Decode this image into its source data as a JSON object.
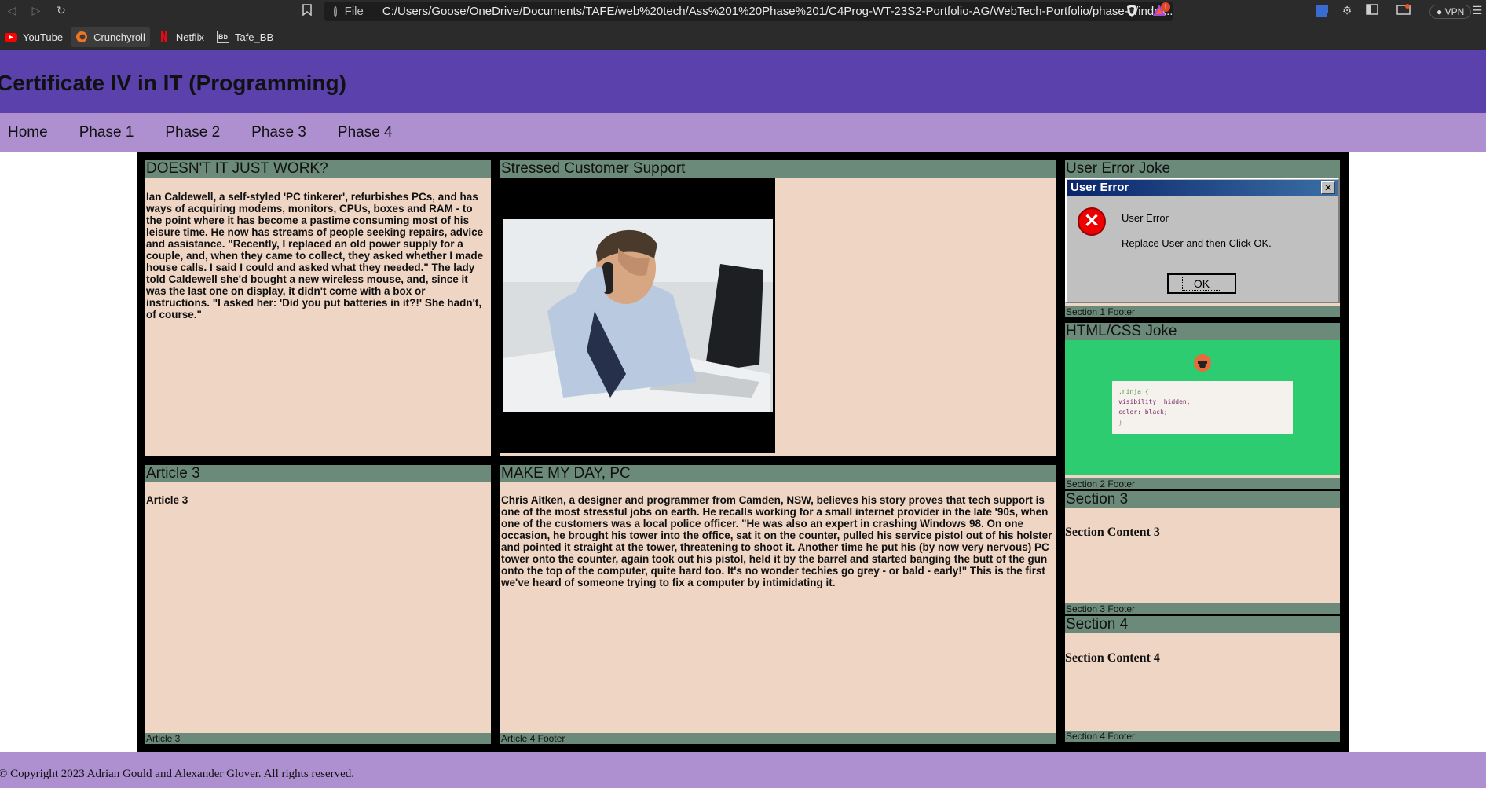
{
  "browser": {
    "address_prefix": "File",
    "url": "C:/Users/Goose/OneDrive/Documents/TAFE/web%20tech/Ass%201%20Phase%201/C4Prog-WT-23S2-Portfolio-AG/WebTech-Portfolio/phase-3/index...",
    "vpn_label": "VPN",
    "notification_count": "1",
    "bookmarks": [
      {
        "label": "YouTube",
        "icon": "youtube-icon"
      },
      {
        "label": "Crunchyroll",
        "icon": "crunchyroll-icon"
      },
      {
        "label": "Netflix",
        "icon": "netflix-icon"
      },
      {
        "label": "Tafe_BB",
        "icon": "blackboard-icon"
      }
    ]
  },
  "site": {
    "title": "Certificate IV in IT (Programming)",
    "nav": [
      "Home",
      "Phase 1",
      "Phase 2",
      "Phase 3",
      "Phase 4"
    ],
    "footer_text": "© Copyright 2023 Adrian Gould and Alexander Glover. All rights reserved."
  },
  "articles": [
    {
      "heading": "DOESN'T IT JUST WORK?",
      "body": "Ian Caldewell, a self-styled 'PC tinkerer', refurbishes PCs, and has ways of acquiring modems, monitors, CPUs, boxes and RAM - to the point where it has become a pastime consuming most of his leisure time. He now has streams of people seeking repairs, advice and assistance. \"Recently, I replaced an old power supply for a couple, and, when they came to collect, they asked whether I made house calls. I said I could and asked what they needed.\" The lady told Caldewell she'd bought a new wireless mouse, and, since it was the last one on display, it didn't come with a box or instructions. \"I asked her: 'Did you put batteries in it?!' She hadn't, of course.\""
    },
    {
      "heading": "Stressed Customer Support"
    },
    {
      "heading": "Article 3",
      "body": "Article 3",
      "footer": "Article 3"
    },
    {
      "heading": "MAKE MY DAY, PC",
      "body": "Chris Aitken, a designer and programmer from Camden, NSW, believes his story proves that tech support is one of the most stressful jobs on earth. He recalls working for a small internet provider in the late '90s, when one of the customers was a local police officer. \"He was also an expert in crashing Windows 98. On one occasion, he brought his tower into the office, sat it on the counter, pulled his service pistol out of his holster and pointed it straight at the tower, threatening to shoot it. Another time he put his (by now very nervous) PC tower onto the counter, again took out his pistol, held it by the barrel and started banging the butt of the gun onto the top of the computer, quite hard too. It's no wonder techies go grey - or bald - early!\" This is the first we've heard of someone trying to fix a computer by intimidating it.",
      "footer": "Article 4 Footer"
    }
  ],
  "sections": [
    {
      "heading": "User Error Joke",
      "footer": "Section 1 Footer",
      "dialog": {
        "title": "User Error",
        "line1": "User Error",
        "line2": "Replace User and then Click OK.",
        "ok": "OK"
      }
    },
    {
      "heading": "HTML/CSS Joke",
      "footer": "Section 2 Footer",
      "code": [
        ".ninja {",
        "visibility: hidden;",
        "color: black;",
        "}"
      ]
    },
    {
      "heading": "Section 3",
      "content": "Section Content 3",
      "footer": "Section 3 Footer"
    },
    {
      "heading": "Section 4",
      "content": "Section Content 4",
      "footer": "Section 4 Footer"
    }
  ],
  "colors": {
    "header_bg": "#5b41ab",
    "nav_bg": "#ae8fd0",
    "card_bg": "#efd5c4",
    "card_bar": "#6b8a7a",
    "joke_bg": "#2ecc71"
  }
}
